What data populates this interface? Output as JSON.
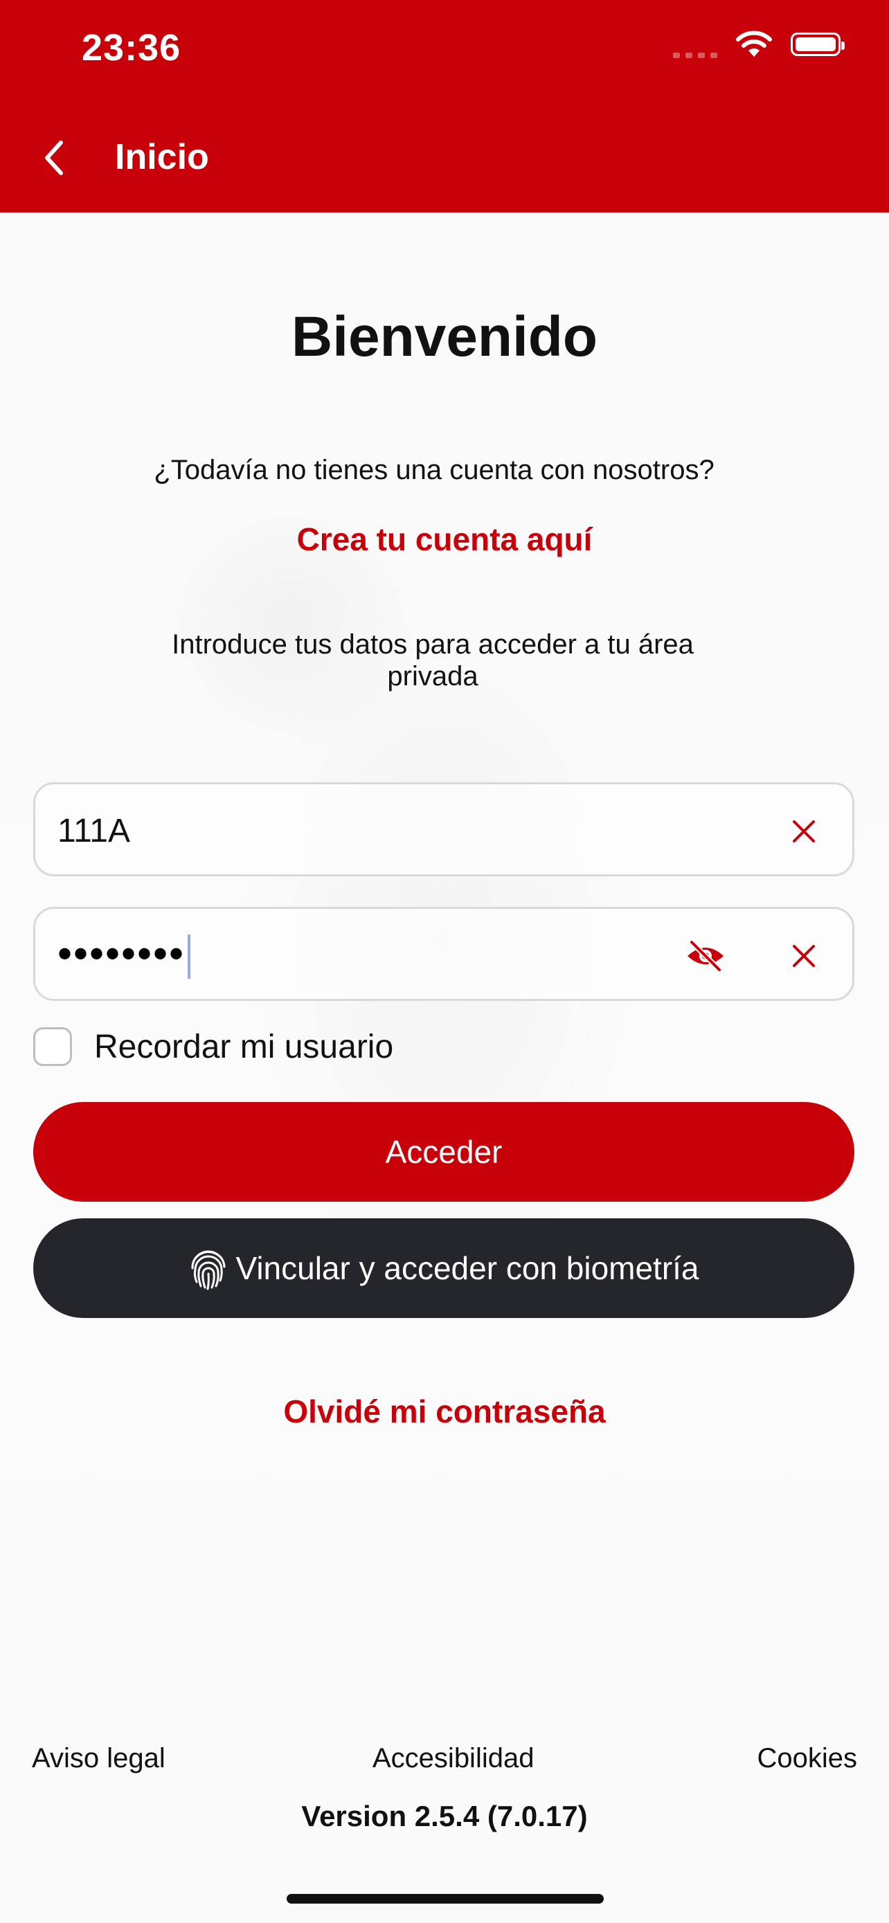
{
  "status_bar": {
    "time": "23:36"
  },
  "nav": {
    "title": "Inicio"
  },
  "login": {
    "title": "Bienvenido",
    "question": "¿Todavía no tienes una cuenta con nosotros?",
    "create_link": "Crea tu cuenta aquí",
    "intro": "Introduce tus datos para acceder a tu área privada",
    "username_value": "111A",
    "password_value": "••••••••",
    "remember_label": "Recordar mi usuario",
    "access_button": "Acceder",
    "biometric_button": "Vincular y acceder con biometría",
    "forgot_link": "Olvidé mi contraseña"
  },
  "footer": {
    "legal": "Aviso legal",
    "accessibility": "Accesibilidad",
    "cookies": "Cookies",
    "version": "Version 2.5.4 (7.0.17)"
  },
  "colors": {
    "brand_red": "#c8000a",
    "dark_button": "#24262b"
  },
  "icons": [
    "back-chevron-icon",
    "wifi-icon",
    "battery-icon",
    "clear-icon",
    "eye-slash-icon",
    "fingerprint-icon"
  ]
}
